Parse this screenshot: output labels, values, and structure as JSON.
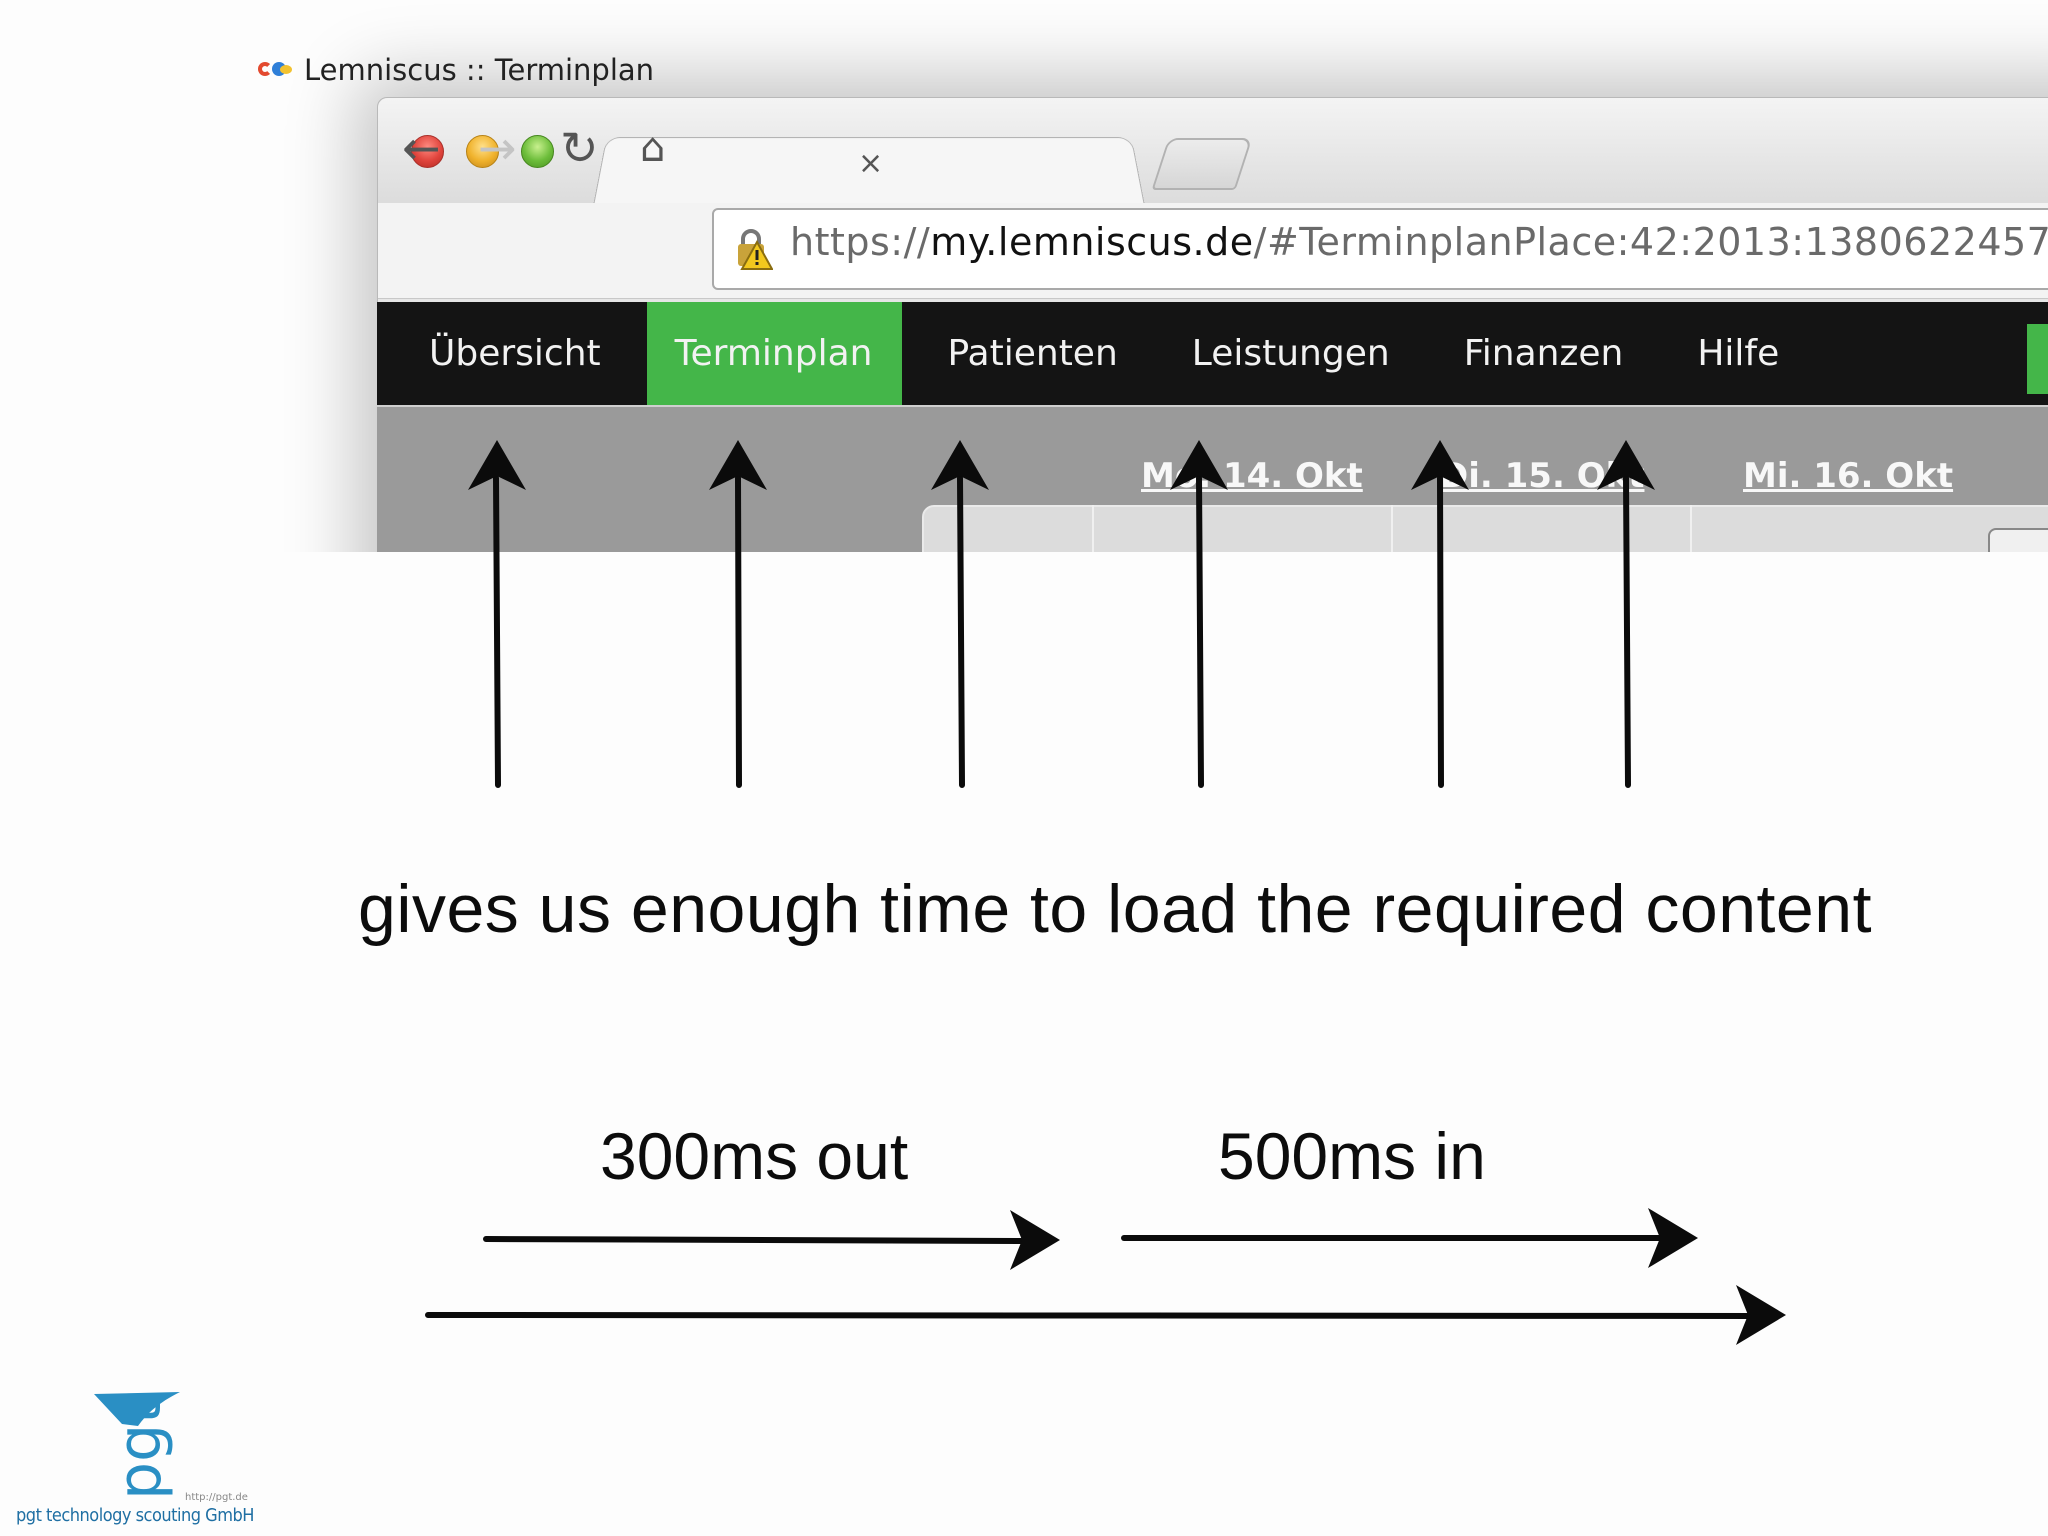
{
  "browser": {
    "tab_title": "Lemniscus :: Terminplan",
    "tab_close": "×",
    "url_scheme": "https://",
    "url_host": "my.lemniscus.de",
    "url_path": "/#TerminplanPlace:42:2013:1380622457"
  },
  "app_nav": {
    "items": [
      {
        "label": "Übersicht"
      },
      {
        "label": "Terminplan",
        "active": true
      },
      {
        "label": "Patienten"
      },
      {
        "label": "Leistungen"
      },
      {
        "label": "Finanzen"
      },
      {
        "label": "Hilfe"
      }
    ],
    "active_color": "#44b649"
  },
  "calendar": {
    "days": [
      "Mo. 14. Okt",
      "Di. 15. Okt",
      "Mi. 16. Okt"
    ]
  },
  "slide": {
    "caption": "gives us enough time to load the required content",
    "timing_out": "300ms out",
    "timing_in": "500ms in"
  },
  "brand": {
    "logo_text": "pgt",
    "company": "pgt technology scouting GmbH",
    "url": "http://pgt.de"
  },
  "icons": [
    "back-arrow-icon",
    "forward-arrow-icon",
    "reload-icon",
    "home-icon",
    "warning-lock-icon",
    "lemniscus-favicon"
  ]
}
